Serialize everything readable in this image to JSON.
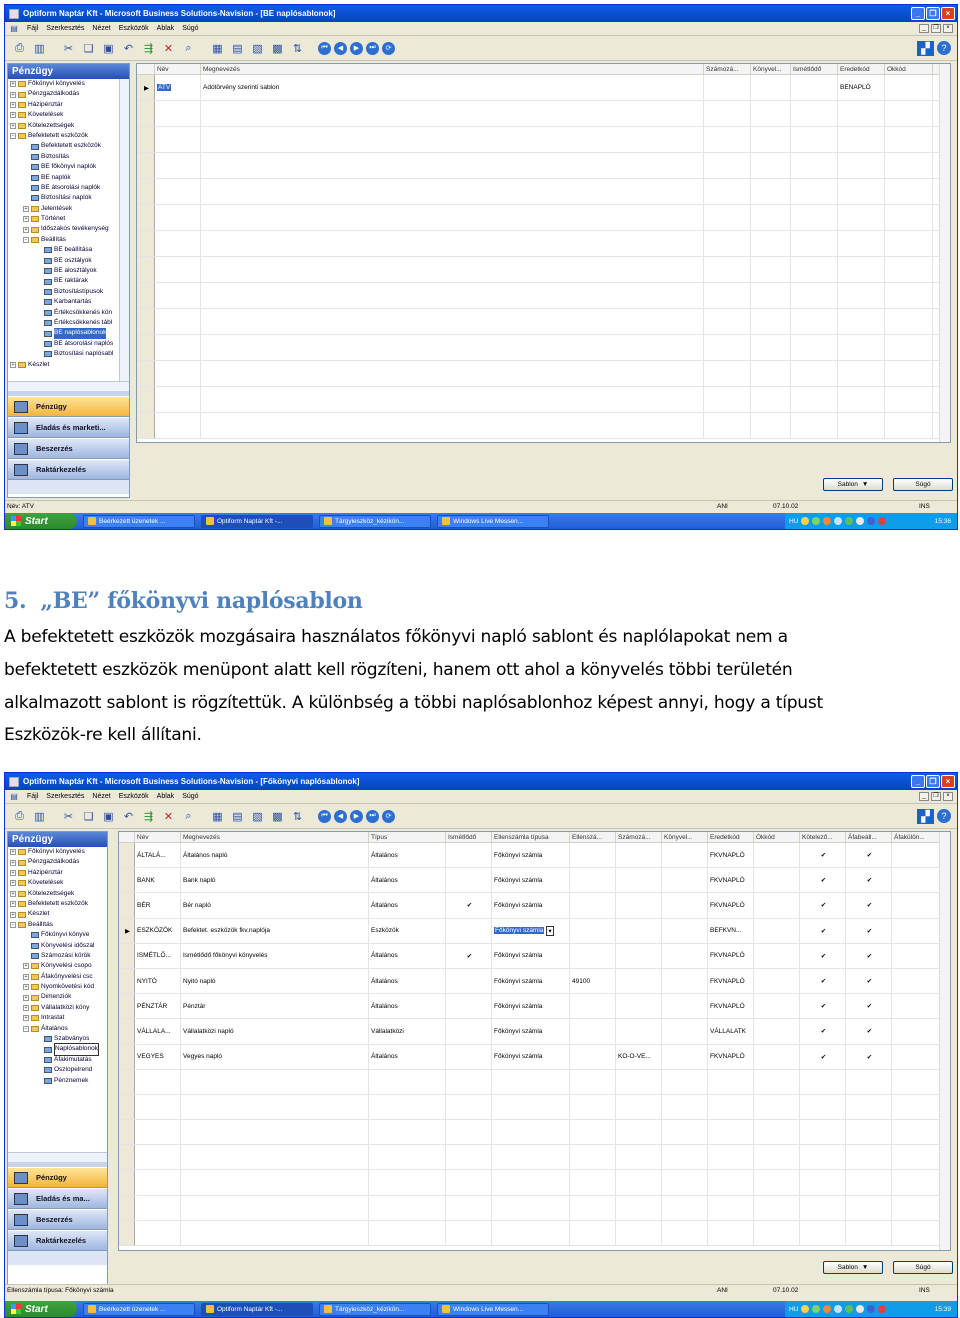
{
  "screenshot1": {
    "title": "Optiform Naptár Kft - Microsoft Business Solutions-Navision - [BE naplósablonok]",
    "menu": [
      "Fájl",
      "Szerkesztés",
      "Nézet",
      "Eszközök",
      "Ablak",
      "Súgó"
    ],
    "nav_title": "Pénzügy",
    "tree": [
      {
        "label": "Főkönyvi könyvelés",
        "level": 0,
        "icon": "folder"
      },
      {
        "label": "Pénzgazdálkodás",
        "level": 0,
        "icon": "folder"
      },
      {
        "label": "Házipénztár",
        "level": 0,
        "icon": "folder"
      },
      {
        "label": "Követelések",
        "level": 0,
        "icon": "folder"
      },
      {
        "label": "Kötelezettségek",
        "level": 0,
        "icon": "folder"
      },
      {
        "label": "Befektetett eszközök",
        "level": 0,
        "icon": "open"
      },
      {
        "label": "Befektetett eszközök",
        "level": 1,
        "icon": "form"
      },
      {
        "label": "Biztosítás",
        "level": 1,
        "icon": "form"
      },
      {
        "label": "BE főkönyvi naplók",
        "level": 1,
        "icon": "form"
      },
      {
        "label": "BE naplók",
        "level": 1,
        "icon": "form"
      },
      {
        "label": "BE átsorolási naplók",
        "level": 1,
        "icon": "form"
      },
      {
        "label": "Biztosítási naplók",
        "level": 1,
        "icon": "form"
      },
      {
        "label": "Jelentések",
        "level": 1,
        "icon": "folder"
      },
      {
        "label": "Történet",
        "level": 1,
        "icon": "folder"
      },
      {
        "label": "Időszakos tevékenység",
        "level": 1,
        "icon": "folder"
      },
      {
        "label": "Beállítás",
        "level": 1,
        "icon": "open"
      },
      {
        "label": "BE beállítása",
        "level": 2,
        "icon": "form"
      },
      {
        "label": "BE osztályok",
        "level": 2,
        "icon": "form"
      },
      {
        "label": "BE alosztályok",
        "level": 2,
        "icon": "form"
      },
      {
        "label": "BE raktárak",
        "level": 2,
        "icon": "form"
      },
      {
        "label": "Biztosítástípusok",
        "level": 2,
        "icon": "form"
      },
      {
        "label": "Karbantartás",
        "level": 2,
        "icon": "form"
      },
      {
        "label": "Értékcsökkenés kön",
        "level": 2,
        "icon": "form"
      },
      {
        "label": "Értékcsökkenés tábl",
        "level": 2,
        "icon": "form"
      },
      {
        "label": "BE naplósablonok",
        "level": 2,
        "icon": "form",
        "selected": true
      },
      {
        "label": "BE átsorolási naplós",
        "level": 2,
        "icon": "form"
      },
      {
        "label": "Biztosítási naplósabl",
        "level": 2,
        "icon": "form"
      },
      {
        "label": "Készlet",
        "level": 0,
        "icon": "folder"
      }
    ],
    "nav_buttons": [
      "Pénzügy",
      "Eladás és marketi...",
      "Beszerzés",
      "Raktárkezelés"
    ],
    "columns": [
      "Név",
      "Megnevezés",
      "Számozá...",
      "Könyvel...",
      "Ismétlődő",
      "Eredetkód",
      "Okkód"
    ],
    "rows": [
      {
        "nev": "ATV",
        "megnevezes": "Adótörvény szerinti sablon",
        "szamozas": "",
        "konyvel": "",
        "ismetlodo": "",
        "eredetkod": "BENAPLÓ",
        "okkod": ""
      }
    ],
    "btn_sablon": "Sablon",
    "btn_sugo": "Súgó",
    "status_left": "Név: ATV",
    "status_user": "ANI",
    "status_date": "07.10.02",
    "status_ins": "INS",
    "start": "Start",
    "tasks": [
      "Beérkezett üzenetek ...",
      "Optiform Naptár Kft -...",
      "Tárgyieszköz_kézikön...",
      "Windows Live Messen..."
    ],
    "tray_lang": "HU",
    "clock": "15:36"
  },
  "document": {
    "heading_num": "5.",
    "heading_text": "„BE” főkönyvi naplósablon",
    "lines": [
      "A befektetett eszközök mozgásaira használatos főkönyvi napló sablont és naplólapokat nem a",
      "befektetett eszközök menüpont alatt kell rögzíteni, hanem ott ahol a könyvelés többi területén",
      "alkalmazott sablont is rögzítettük. A különbség a többi naplósablonhoz képest annyi, hogy a típust",
      "Eszközök-re kell állítani."
    ]
  },
  "screenshot2": {
    "title": "Optiform Naptár Kft - Microsoft Business Solutions-Navision - [Főkönyvi naplósablonok]",
    "menu": [
      "Fájl",
      "Szerkesztés",
      "Nézet",
      "Eszközök",
      "Ablak",
      "Súgó"
    ],
    "nav_title": "Pénzügy",
    "tree": [
      {
        "label": "Főkönyvi könyvelés",
        "level": 0,
        "icon": "folder"
      },
      {
        "label": "Pénzgazdálkodás",
        "level": 0,
        "icon": "folder"
      },
      {
        "label": "Házipénztár",
        "level": 0,
        "icon": "folder"
      },
      {
        "label": "Követelések",
        "level": 0,
        "icon": "folder"
      },
      {
        "label": "Kötelezettségek",
        "level": 0,
        "icon": "folder"
      },
      {
        "label": "Befektetett eszközök",
        "level": 0,
        "icon": "folder"
      },
      {
        "label": "Készlet",
        "level": 0,
        "icon": "folder"
      },
      {
        "label": "Beállítás",
        "level": 0,
        "icon": "open"
      },
      {
        "label": "Főkönyvi könyve",
        "level": 1,
        "icon": "form"
      },
      {
        "label": "Könyvelési időszal",
        "level": 1,
        "icon": "form"
      },
      {
        "label": "Számozási körök",
        "level": 1,
        "icon": "form"
      },
      {
        "label": "Könyvelési csopo",
        "level": 1,
        "icon": "folder"
      },
      {
        "label": "Áfakönyvelési csc",
        "level": 1,
        "icon": "folder"
      },
      {
        "label": "Nyomkövetési kód",
        "level": 1,
        "icon": "folder"
      },
      {
        "label": "Dimenziók",
        "level": 1,
        "icon": "folder"
      },
      {
        "label": "Vállalatközi köny",
        "level": 1,
        "icon": "folder"
      },
      {
        "label": "Intrastat",
        "level": 1,
        "icon": "folder"
      },
      {
        "label": "Általános",
        "level": 1,
        "icon": "open"
      },
      {
        "label": "Szabványos",
        "level": 2,
        "icon": "form"
      },
      {
        "label": "Naplósablonok",
        "level": 2,
        "icon": "form",
        "boxed": true
      },
      {
        "label": "Áfakimutatás",
        "level": 2,
        "icon": "form"
      },
      {
        "label": "Oszlopelrend",
        "level": 2,
        "icon": "form"
      },
      {
        "label": "Pénznemek",
        "level": 2,
        "icon": "form"
      }
    ],
    "nav_buttons": [
      "Pénzügy",
      "Eladás és ma...",
      "Beszerzés",
      "Raktárkezelés"
    ],
    "columns": [
      "Név",
      "Megnevezés",
      "Típus",
      "Ismétlődő",
      "Ellenszámla típusa",
      "Ellenszá...",
      "Számozá...",
      "Könyvel...",
      "Eredetkód",
      "Okkód",
      "Kötelező...",
      "Áfabeáll...",
      "Áfakülön..."
    ],
    "rows": [
      {
        "nev": "ÁLTALÁ...",
        "megnevezes": "Általános napló",
        "tipus": "Általános",
        "ism": "",
        "ell_tipus": "Főkönyvi számla",
        "ell": "",
        "szam": "",
        "konyv": "",
        "ered": "FKVNAPLÓ",
        "ok": "",
        "kot": "✔",
        "afab": "✔",
        "afak": ""
      },
      {
        "nev": "BANK",
        "megnevezes": "Bank napló",
        "tipus": "Általános",
        "ism": "",
        "ell_tipus": "Főkönyvi számla",
        "ell": "",
        "szam": "",
        "konyv": "",
        "ered": "FKVNAPLÓ",
        "ok": "",
        "kot": "✔",
        "afab": "✔",
        "afak": ""
      },
      {
        "nev": "BÉR",
        "megnevezes": "Bér napló",
        "tipus": "Általános",
        "ism": "✔",
        "ell_tipus": "Főkönyvi számla",
        "ell": "",
        "szam": "",
        "konyv": "",
        "ered": "FKVNAPLÓ",
        "ok": "",
        "kot": "✔",
        "afab": "✔",
        "afak": ""
      },
      {
        "nev": "ESZKÖZÖK",
        "megnevezes": "Befektet. eszközök fkv.naplója",
        "tipus": "Eszközök",
        "ism": "",
        "ell_tipus": "Főkönyvi számla",
        "ell": "",
        "szam": "",
        "konyv": "",
        "ered": "BEFKVN...",
        "ok": "",
        "kot": "✔",
        "afab": "✔",
        "afak": "",
        "current": true
      },
      {
        "nev": "ISMÉTLŐ...",
        "megnevezes": "Ismétlődő főkönyvi könyvelés",
        "tipus": "Általános",
        "ism": "✔",
        "ell_tipus": "Főkönyvi számla",
        "ell": "",
        "szam": "",
        "konyv": "",
        "ered": "FKVNAPLÓ",
        "ok": "",
        "kot": "✔",
        "afab": "✔",
        "afak": ""
      },
      {
        "nev": "NYITÓ",
        "megnevezes": "Nyitó napló",
        "tipus": "Általános",
        "ism": "",
        "ell_tipus": "Főkönyvi számla",
        "ell": "49100",
        "szam": "",
        "konyv": "",
        "ered": "FKVNAPLÓ",
        "ok": "",
        "kot": "✔",
        "afab": "✔",
        "afak": ""
      },
      {
        "nev": "PÉNZTÁR",
        "megnevezes": "Pénztár",
        "tipus": "Általános",
        "ism": "",
        "ell_tipus": "Főkönyvi számla",
        "ell": "",
        "szam": "",
        "konyv": "",
        "ered": "FKVNAPLÓ",
        "ok": "",
        "kot": "✔",
        "afab": "✔",
        "afak": ""
      },
      {
        "nev": "VÁLLALA...",
        "megnevezes": "Vállalatközi napló",
        "tipus": "Vállalatközi",
        "ism": "",
        "ell_tipus": "Főkönyvi számla",
        "ell": "",
        "szam": "",
        "konyv": "",
        "ered": "VÁLLALATK",
        "ok": "",
        "kot": "✔",
        "afab": "✔",
        "afak": ""
      },
      {
        "nev": "VEGYES",
        "megnevezes": "Vegyes napló",
        "tipus": "Általános",
        "ism": "",
        "ell_tipus": "Főkönyvi számla",
        "ell": "",
        "szam": "KO-O-VE...",
        "konyv": "",
        "ered": "FKVNAPLÓ",
        "ok": "",
        "kot": "✔",
        "afab": "✔",
        "afak": ""
      }
    ],
    "btn_sablon": "Sablon",
    "btn_sugo": "Súgó",
    "status_left": "Ellenszámla típusa: Főkönyvi számla",
    "status_user": "ANI",
    "status_date": "07.10.02",
    "status_ins": "INS",
    "start": "Start",
    "tasks": [
      "Beérkezett üzenetek ...",
      "Optiform Naptár Kft -...",
      "Tárgyieszköz_kézikön...",
      "Windows Live Messen..."
    ],
    "tray_lang": "HU",
    "clock": "15:39"
  }
}
